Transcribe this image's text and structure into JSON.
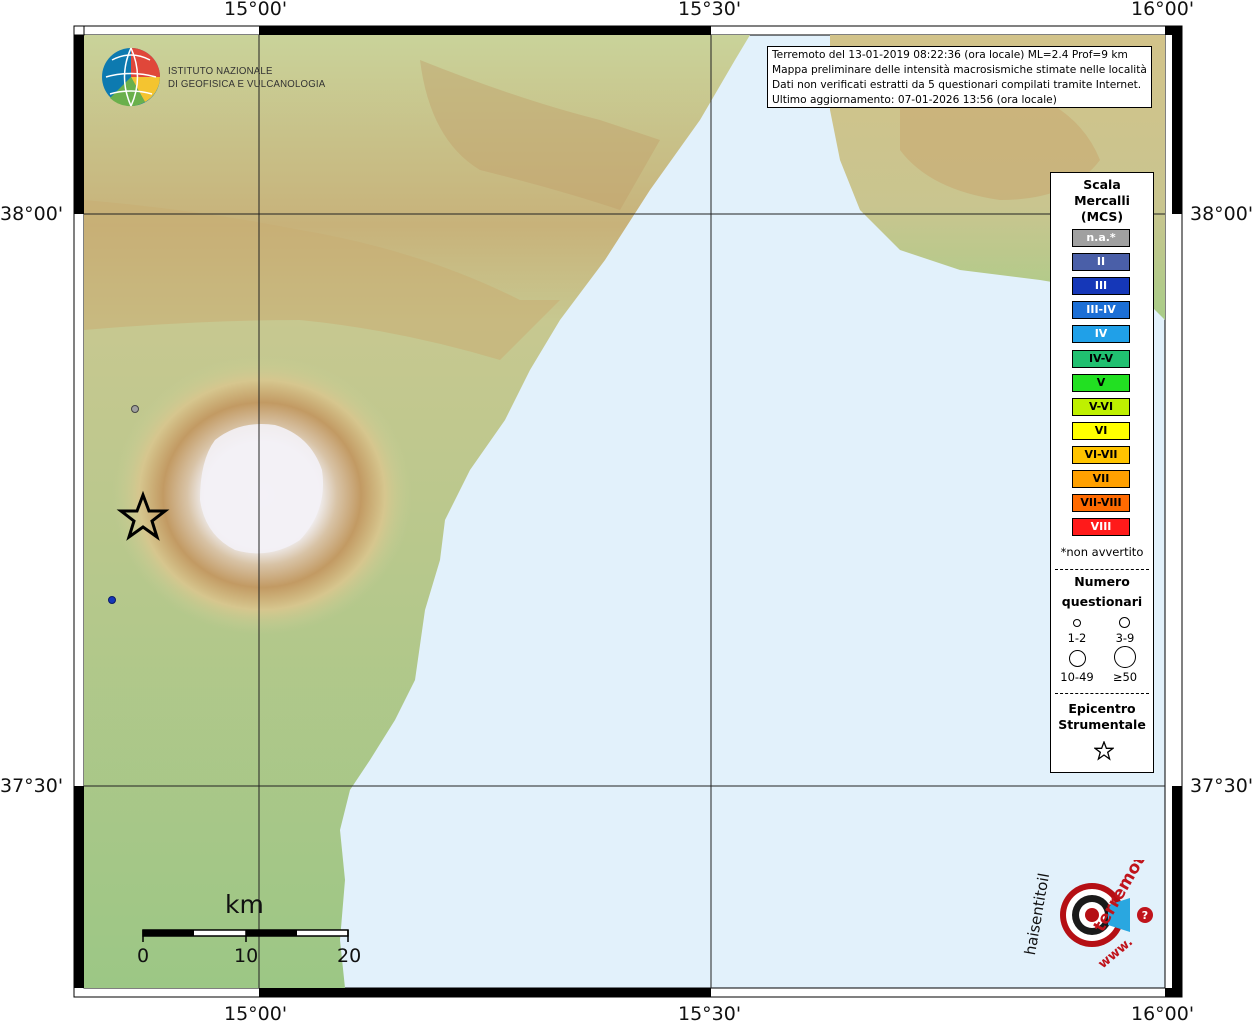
{
  "map": {
    "colors": {
      "sea": "#e2f1fb",
      "lowland": "#b8d294",
      "hill": "#d7d49c",
      "mountain": "#b78c55",
      "summit": "#f4f2f6",
      "frame": "#000000"
    },
    "lon_labels": [
      "15°00'",
      "15°30'",
      "16°00'"
    ],
    "lat_labels": [
      "38°00'",
      "37°30'"
    ]
  },
  "header": {
    "line1": "Terremoto del 13-01-2019 08:22:36 (ora locale) ML=2.4 Prof=9 km",
    "line2": "Mappa preliminare delle intensità macrosismiche stimate nelle località",
    "line3": "Dati non verificati estratti da 5 questionari compilati tramite Internet.",
    "line4": "Ultimo aggiornamento: 07-01-2026 13:56 (ora locale)"
  },
  "logo_ingv": {
    "line1": "ISTITUTO NAZIONALE",
    "line2": "DI GEOFISICA E VULCANOLOGIA"
  },
  "legend": {
    "title1": "Scala",
    "title2": "Mercalli",
    "title3": "(MCS)",
    "levels": [
      {
        "label": "n.a.*",
        "color": "#a0a0a0",
        "text": "#ffffff"
      },
      {
        "label": "II",
        "color": "#4a5fa8",
        "text": "#ffffff"
      },
      {
        "label": "III",
        "color": "#1537b8",
        "text": "#ffffff"
      },
      {
        "label": "III-IV",
        "color": "#1c6fd6",
        "text": "#ffffff"
      },
      {
        "label": "IV",
        "color": "#20a0e8",
        "text": "#ffffff"
      },
      {
        "label": "IV-V",
        "color": "#20c070",
        "text": "#000000"
      },
      {
        "label": "V",
        "color": "#22e022",
        "text": "#000000"
      },
      {
        "label": "V-VI",
        "color": "#bef000",
        "text": "#000000"
      },
      {
        "label": "VI",
        "color": "#ffff00",
        "text": "#000000"
      },
      {
        "label": "VI-VII",
        "color": "#ffc400",
        "text": "#000000"
      },
      {
        "label": "VII",
        "color": "#ffa000",
        "text": "#000000"
      },
      {
        "label": "VII-VIII",
        "color": "#ff6a00",
        "text": "#000000"
      },
      {
        "label": "VIII",
        "color": "#ff1a1a",
        "text": "#ffffff"
      }
    ],
    "na_note": "*non avvertito",
    "count_title1": "Numero",
    "count_title2": "questionari",
    "counts": [
      "1-2",
      "3-9",
      "10-49",
      "≥50"
    ],
    "epi_title1": "Epicentro",
    "epi_title2": "Strumentale"
  },
  "scale_bar": {
    "unit": "km",
    "labels": [
      "0",
      "10",
      "20"
    ]
  },
  "observations": [
    {
      "name": "questionnaire-point-1",
      "color": "#a0a0a0"
    },
    {
      "name": "questionnaire-point-2",
      "color": "#1537b8"
    }
  ],
  "hsit_logo": {
    "text_red": "terremoto.it",
    "text_black": "haisentitoil",
    "text_www": "www."
  }
}
